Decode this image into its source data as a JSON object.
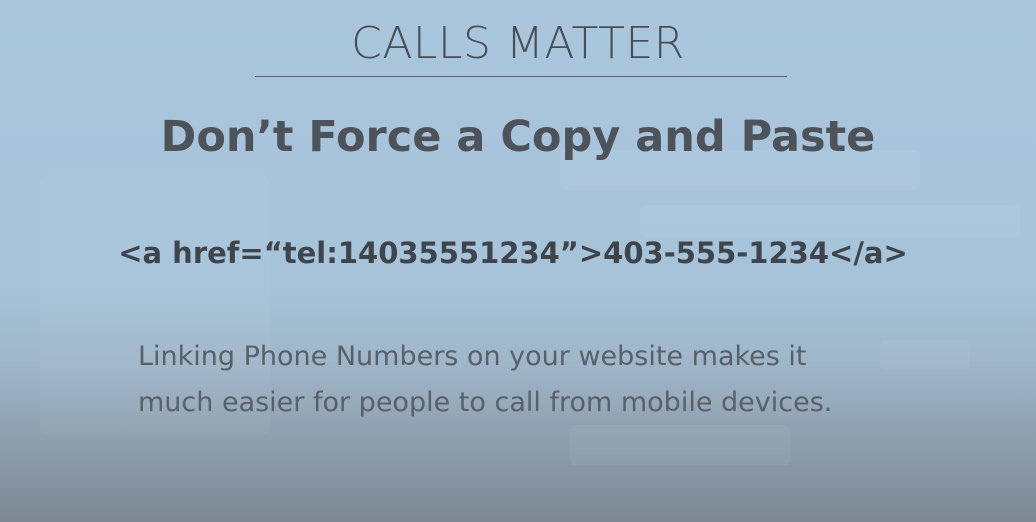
{
  "slide": {
    "title": "CALLS MATTER",
    "subtitle": "Don’t Force a Copy and Paste",
    "code_example": "<a href=“tel:14035551234”>403-555-1234</a>",
    "body_lines": [
      "Linking Phone Numbers on your website makes it",
      "much easier for people to call from mobile devices."
    ]
  },
  "colors": {
    "background": "#a9c6dd",
    "title_text": "#4a4f55",
    "body_text": "#5a6068"
  }
}
